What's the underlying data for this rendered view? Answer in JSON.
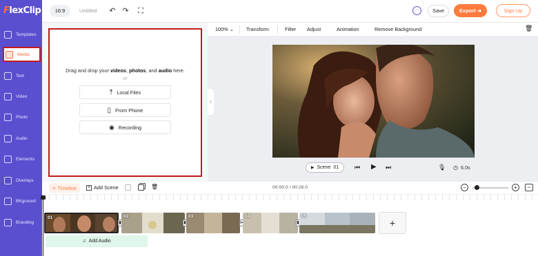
{
  "app": {
    "logo": "FlexClip",
    "logo_first": "F",
    "logo_rest": "lexClip"
  },
  "sidebar": {
    "items": [
      {
        "label": "Templates",
        "icon": "templates-icon"
      },
      {
        "label": "Media",
        "icon": "media-icon",
        "active": true
      },
      {
        "label": "Text",
        "icon": "text-icon"
      },
      {
        "label": "Video",
        "icon": "video-icon"
      },
      {
        "label": "Photo",
        "icon": "photo-icon"
      },
      {
        "label": "Audio",
        "icon": "audio-icon"
      },
      {
        "label": "Elements",
        "icon": "elements-icon"
      },
      {
        "label": "Overlays",
        "icon": "overlays-icon"
      },
      {
        "label": "BKground",
        "icon": "background-icon"
      },
      {
        "label": "Branding",
        "icon": "branding-icon"
      }
    ]
  },
  "topbar": {
    "ratio": "16:9",
    "title": "Untitled",
    "undo_icon": "↶",
    "redo_icon": "↷",
    "fullscreen_icon": "⛶",
    "chat_icon": "···",
    "save": "Save",
    "export": "Export",
    "export_arrow": "➜",
    "signup": "Sign Up"
  },
  "media_panel": {
    "drop_prefix": "Drag and drop your",
    "drop_videos": "videos",
    "drop_sep1": ",",
    "drop_photos": "photos",
    "drop_sep2": ", and",
    "drop_audio": "audio",
    "drop_suffix": "here.",
    "or": "or",
    "buttons": [
      {
        "label": "Local Files",
        "icon": "upload-icon",
        "glyph": "⤒"
      },
      {
        "label": "From Phone",
        "icon": "phone-icon",
        "glyph": "▯"
      },
      {
        "label": "Recording",
        "icon": "record-icon",
        "glyph": "◉"
      }
    ]
  },
  "edit_toolbar": {
    "zoom": "100%",
    "zoom_caret": "⌄",
    "items": [
      "Transform",
      "Filter",
      "Adjust",
      "Animation",
      "Remove Background"
    ],
    "trash_icon": "🗑"
  },
  "preview": {
    "scene_label": "Scene",
    "scene_number": "01",
    "prev_icon": "⏮",
    "play_icon": "▶",
    "next_icon": "⏭",
    "mic_icon": "🎙",
    "clock_icon": "◷",
    "duration": "6.0s",
    "collapse_icon": "‹"
  },
  "timeline": {
    "tab": "Timeline",
    "add_scene": "Add Scene",
    "time": "00:00.0 / 00:26.0",
    "zoom_out": "−",
    "zoom_in": "+",
    "fit_icon": "⇔",
    "zoom_level": 0.1,
    "clips": [
      {
        "number": "01",
        "selected": true
      },
      {
        "number": "02"
      },
      {
        "number": "03"
      },
      {
        "number": "04"
      },
      {
        "number": "05"
      }
    ],
    "add_clip": "+",
    "add_audio": "Add Audio",
    "music_icon": "♫"
  }
}
